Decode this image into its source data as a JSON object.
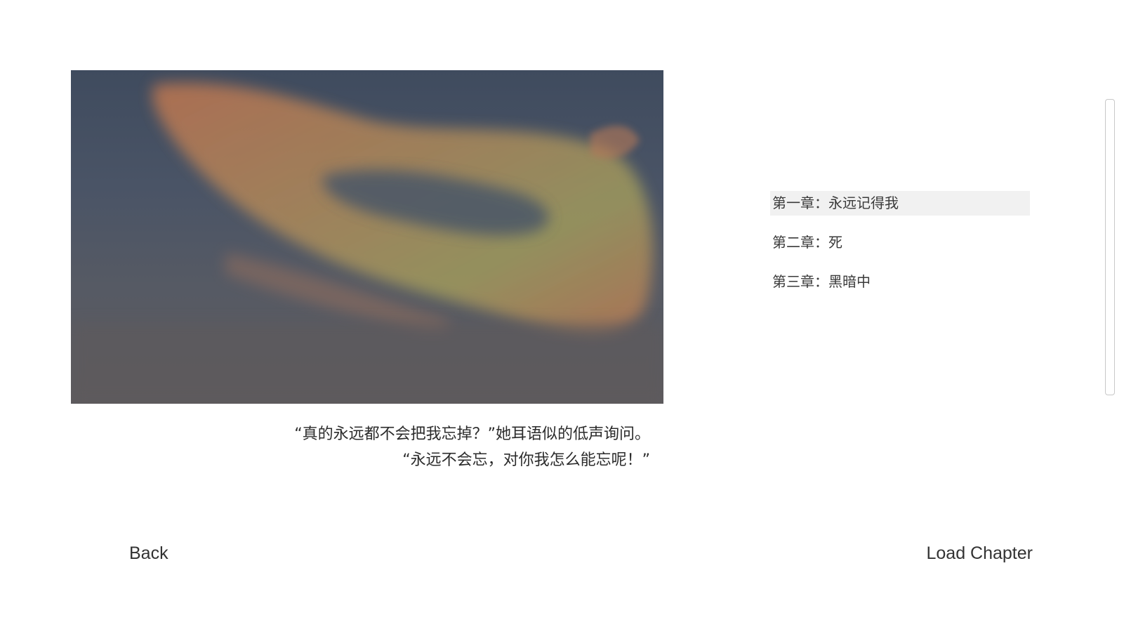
{
  "preview": {
    "image": "sunset-clouds-image",
    "colors": {
      "sky_top": "#3f4b5e",
      "sky_bottom": "#5d5b5e",
      "cloud_orange": "#c97a52",
      "cloud_olive": "#a99a5a"
    }
  },
  "quote": {
    "line1": "“真的永远都不会把我忘掉？”她耳语似的低声询问。",
    "line2": "“永远不会忘，对你我怎么能忘呢！”"
  },
  "chapters": [
    {
      "label": "第一章：永远记得我",
      "selected": true
    },
    {
      "label": "第二章：死",
      "selected": false
    },
    {
      "label": "第三章：黑暗中",
      "selected": false
    }
  ],
  "buttons": {
    "back_label": "Back",
    "load_label": "Load Chapter"
  }
}
